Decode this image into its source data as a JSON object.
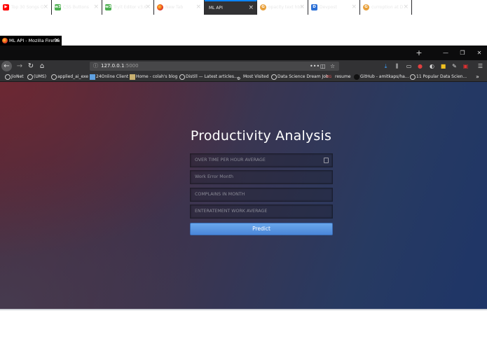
{
  "window": {
    "title": "ML API - Mozilla Firefox"
  },
  "tabs": [
    {
      "label": "Top 30 Songs O",
      "icon": "youtube-icon",
      "color": "#ff0000"
    },
    {
      "label": "CSS Buttons",
      "icon": "w3schools-icon",
      "color": "#4caf50"
    },
    {
      "label": "Tryit Editor v3.6",
      "icon": "w3schools-icon",
      "color": "#4caf50"
    },
    {
      "label": "New Tab",
      "icon": "firefox-icon",
      "color": "#ff7139"
    },
    {
      "label": "ML API",
      "icon": "none",
      "color": "#323234"
    },
    {
      "label": "opacity text htm",
      "icon": "google-icon",
      "color": "#e8a03a"
    },
    {
      "label": "Devpost",
      "icon": "devpost-icon",
      "color": "#2a6fd6"
    },
    {
      "label": "curroption at D",
      "icon": "google-icon",
      "color": "#e8a03a"
    }
  ],
  "nav": {
    "url_host": "127.0.0.1",
    "url_port": ":5000",
    "new_tab": "+"
  },
  "bookmarks": [
    {
      "label": "JioNet"
    },
    {
      "label": "(UMS)"
    },
    {
      "label": "applied_ai_exe"
    },
    {
      "label": "24Online Client"
    },
    {
      "label": "Home - colah's blog"
    },
    {
      "label": "Distill — Latest articles..."
    },
    {
      "label": "Most Visited"
    },
    {
      "label": "Data Science Dream Job"
    },
    {
      "label": "resume"
    },
    {
      "label": "GitHub - amitkaps/ha..."
    },
    {
      "label": "11 Popular Data Scien..."
    }
  ],
  "page": {
    "heading": "Productivity Analysis",
    "fields": [
      {
        "placeholder": "OVER TIME PER HOUR AVERAGE"
      },
      {
        "placeholder": "Work Error Month"
      },
      {
        "placeholder": "COMPLAINS IN MONTH"
      },
      {
        "placeholder": "ENTERATEMENT WORK AVERAGE"
      }
    ],
    "predict_label": "Predict"
  },
  "colors": {
    "accent": "#0a84ff",
    "button": "#5a96e2"
  }
}
